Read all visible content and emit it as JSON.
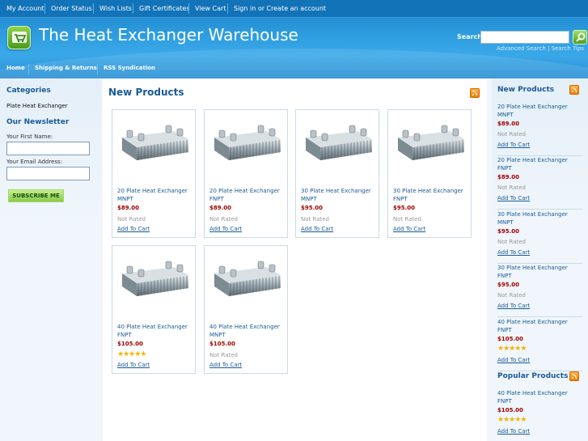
{
  "topnav": {
    "items": [
      "My Account",
      "Order Status",
      "Wish Lists",
      "Gift Certificates",
      "View Cart",
      "Sign in or Create an account"
    ]
  },
  "header": {
    "store_title": "The Heat Exchanger Warehouse",
    "search_label": "Search",
    "search_value": "",
    "advanced_search": "Advanced Search",
    "search_tips": "Search Tips",
    "link_separator": " | "
  },
  "mainnav": {
    "items": [
      "Home",
      "Shipping & Returns",
      "RSS Syndication"
    ]
  },
  "sidebar": {
    "categories_heading": "Categories",
    "categories": [
      "Plate Heat Exchanger"
    ],
    "newsletter_heading": "Our Newsletter",
    "first_name_label": "Your First Name:",
    "email_label": "Your Email Address:",
    "subscribe_label": "SUBSCRIBE ME"
  },
  "main": {
    "heading": "New Products",
    "products": [
      {
        "name": "20 Plate Heat Exchanger MNPT",
        "price": "$89.00",
        "rating": "Not Rated",
        "stars": 0,
        "add": "Add To Cart"
      },
      {
        "name": "20 Plate Heat Exchanger FNPT",
        "price": "$89.00",
        "rating": "Not Rated",
        "stars": 0,
        "add": "Add To Cart"
      },
      {
        "name": "30 Plate Heat Exchanger MNPT",
        "price": "$95.00",
        "rating": "Not Rated",
        "stars": 0,
        "add": "Add To Cart"
      },
      {
        "name": "30 Plate Heat Exchanger FNPT",
        "price": "$95.00",
        "rating": "Not Rated",
        "stars": 0,
        "add": "Add To Cart"
      },
      {
        "name": "40 Plate Heat Exchanger FNPT",
        "price": "$105.00",
        "rating": "",
        "stars": 5,
        "add": "Add To Cart"
      },
      {
        "name": "40 Plate Heat Exchanger MNPT",
        "price": "$105.00",
        "rating": "Not Rated",
        "stars": 0,
        "add": "Add To Cart"
      }
    ]
  },
  "right": {
    "new_heading": "New Products",
    "new_products": [
      {
        "name": "20 Plate Heat Exchanger MNPT",
        "price": "$89.00",
        "rating": "Not Rated",
        "stars": 0,
        "add": "Add To Cart"
      },
      {
        "name": "20 Plate Heat Exchanger FNPT",
        "price": "$89.00",
        "rating": "Not Rated",
        "stars": 0,
        "add": "Add To Cart"
      },
      {
        "name": "30 Plate Heat Exchanger MNPT",
        "price": "$95.00",
        "rating": "Not Rated",
        "stars": 0,
        "add": "Add To Cart"
      },
      {
        "name": "30 Plate Heat Exchanger FNPT",
        "price": "$95.00",
        "rating": "Not Rated",
        "stars": 0,
        "add": "Add To Cart"
      },
      {
        "name": "40 Plate Heat Exchanger FNPT",
        "price": "$105.00",
        "rating": "",
        "stars": 5,
        "add": "Add To Cart"
      }
    ],
    "popular_heading": "Popular Products",
    "popular_products": [
      {
        "name": "40 Plate Heat Exchanger FNPT",
        "price": "$105.00",
        "rating": "",
        "stars": 5,
        "add": "Add To Cart"
      }
    ]
  },
  "colors": {
    "header_blue": "#1a7fc6",
    "heading_blue": "#1a5a96",
    "price_red": "#a00000",
    "star_gold": "#f5b400",
    "rss_orange": "#f07d00",
    "button_green": "#86c94c"
  },
  "icons": [
    "cart-logo-icon",
    "magnifier-icon",
    "rss-icon",
    "star-icon"
  ]
}
